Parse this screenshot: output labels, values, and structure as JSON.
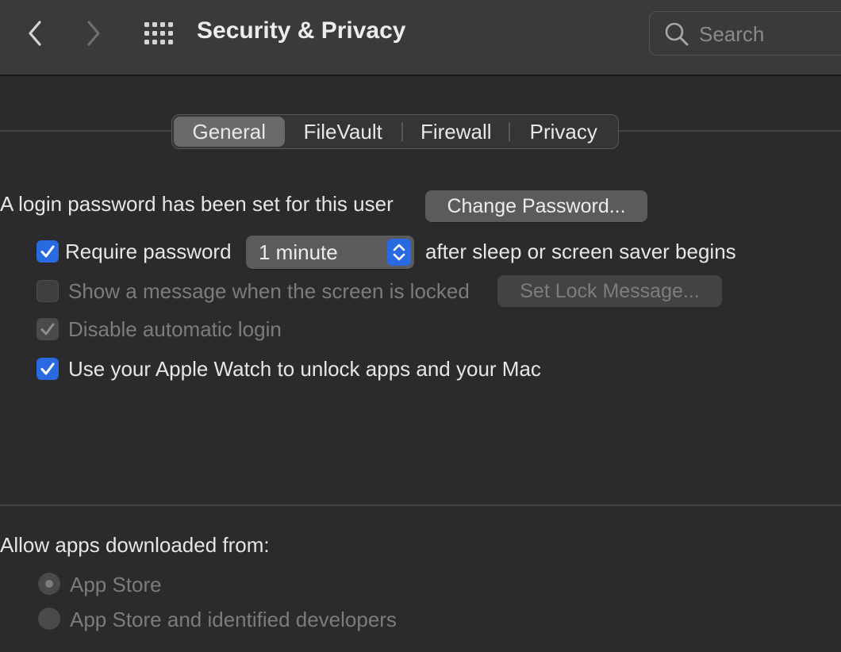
{
  "window": {
    "title": "Security & Privacy"
  },
  "toolbar": {
    "back_icon": "chevron-left-icon",
    "forward_icon": "chevron-right-icon",
    "grid_icon": "show-all-grid-icon"
  },
  "search": {
    "placeholder": "Search",
    "value": ""
  },
  "tabs": [
    {
      "label": "General",
      "selected": true
    },
    {
      "label": "FileVault",
      "selected": false
    },
    {
      "label": "Firewall",
      "selected": false
    },
    {
      "label": "Privacy",
      "selected": false
    }
  ],
  "general": {
    "login_text": "A login password has been set for this user",
    "change_password_label": "Change Password...",
    "require_password": {
      "checked": true,
      "label": "Require password",
      "selected_interval": "1 minute",
      "suffix": "after sleep or screen saver begins"
    },
    "show_message": {
      "checked": false,
      "enabled": false,
      "label": "Show a message when the screen is locked",
      "button_label": "Set Lock Message..."
    },
    "disable_auto_login": {
      "checked": true,
      "enabled": false,
      "label": "Disable automatic login"
    },
    "apple_watch": {
      "checked": true,
      "label": "Use your Apple Watch to unlock apps and your Mac"
    }
  },
  "allow_apps": {
    "heading": "Allow apps downloaded from:",
    "options": [
      {
        "label": "App Store",
        "selected": true,
        "enabled": false
      },
      {
        "label": "App Store and identified developers",
        "selected": false,
        "enabled": false
      }
    ]
  },
  "colors": {
    "accent": "#2a6ae0",
    "window_bg": "#2b2a2c",
    "toolbar_bg": "#3a393b",
    "disabled_text": "#7c7b7e"
  }
}
